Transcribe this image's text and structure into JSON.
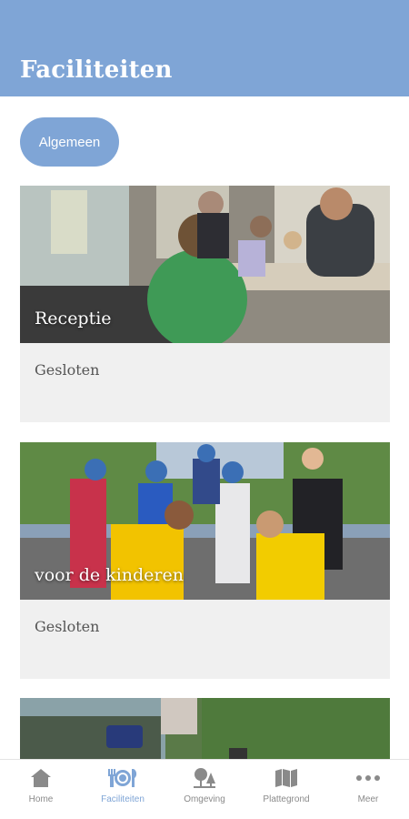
{
  "header": {
    "title": "Faciliteiten"
  },
  "filter": {
    "chip_label": "Algemeen"
  },
  "cards": [
    {
      "title": "Receptie",
      "status": "Gesloten"
    },
    {
      "title": "voor de kinderen",
      "status": "Gesloten"
    },
    {
      "title": "",
      "status": ""
    }
  ],
  "tabbar": {
    "active": "Faciliteiten",
    "tabs": [
      {
        "label": "Home",
        "icon": "home-icon"
      },
      {
        "label": "Faciliteiten",
        "icon": "cutlery-icon"
      },
      {
        "label": "Omgeving",
        "icon": "trees-icon"
      },
      {
        "label": "Plattegrond",
        "icon": "map-icon"
      },
      {
        "label": "Meer",
        "icon": "more-icon"
      }
    ]
  },
  "colors": {
    "accent": "#7fa5d6",
    "card_bg": "#f0f0f0",
    "inactive": "#8a8a8a"
  }
}
